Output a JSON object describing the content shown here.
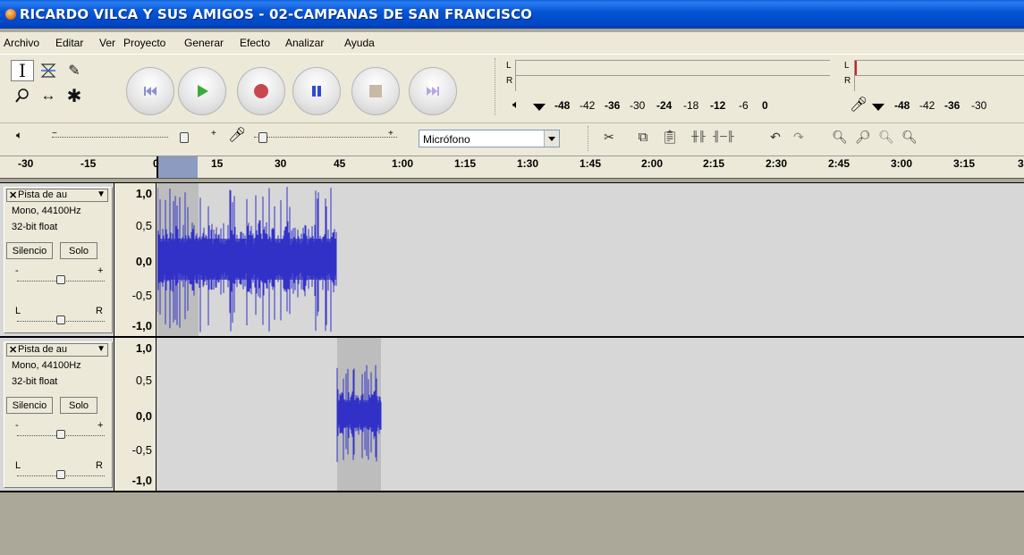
{
  "window": {
    "title": "RICARDO VILCA Y SUS AMIGOS - 02-CAMPANAS DE SAN FRANCISCO"
  },
  "menu": [
    "Archivo",
    "Editar",
    "Ver",
    "Proyecto",
    "Generar",
    "Efecto",
    "Analizar",
    "Ayuda"
  ],
  "tools": {
    "selection": "I",
    "envelope": "envelope",
    "draw": "pencil",
    "zoom": "zoom",
    "timeshift": "↔",
    "multi": "✱"
  },
  "transport": [
    "skip-start",
    "play",
    "record",
    "pause",
    "stop",
    "skip-end"
  ],
  "meters": {
    "play_L": "L",
    "play_R": "R",
    "rec_L": "L",
    "rec_R": "R",
    "play_scale": [
      "-48",
      "-42",
      "-36",
      "-30",
      "-24",
      "-18",
      "-12",
      "-6",
      "0"
    ],
    "rec_scale": [
      "-48",
      "-42",
      "-36",
      "-30"
    ]
  },
  "mixer": {
    "input_source": "Micrófono"
  },
  "ruler": {
    "ticks": [
      "-30",
      "-15",
      "0",
      "15",
      "30",
      "45",
      "1:00",
      "1:15",
      "1:30",
      "1:45",
      "2:00",
      "2:15",
      "2:30",
      "2:45",
      "3:00",
      "3:15",
      "3"
    ],
    "selection_start": 0,
    "selection_end": 7
  },
  "tracks": [
    {
      "name": "Pista de au",
      "rate": "Mono, 44100Hz",
      "format": "32-bit float",
      "mute": "Silencio",
      "solo": "Solo",
      "gain_minus": "-",
      "gain_plus": "+",
      "pan_l": "L",
      "pan_r": "R",
      "scale": [
        "1,0",
        "0,5",
        "0,0",
        "-0,5",
        "-1,0"
      ]
    },
    {
      "name": "Pista de au",
      "rate": "Mono, 44100Hz",
      "format": "32-bit float",
      "mute": "Silencio",
      "solo": "Solo",
      "gain_minus": "-",
      "gain_plus": "+",
      "pan_l": "L",
      "pan_r": "R",
      "scale": [
        "1,0",
        "0,5",
        "0,0",
        "-0,5",
        "-1,0"
      ]
    }
  ],
  "colors": {
    "wave": "#3232c8",
    "titlebar": "#0054e3",
    "selection": "#bdbdbd"
  }
}
